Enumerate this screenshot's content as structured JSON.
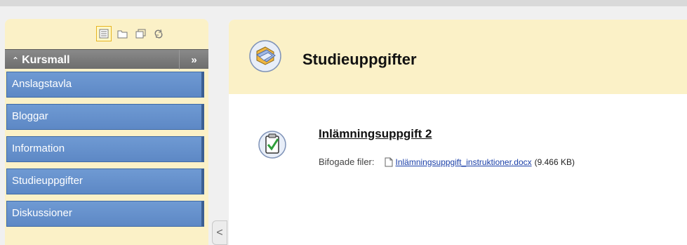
{
  "sidebar": {
    "course_title": "Kursmall",
    "collapse_label": "»",
    "items": [
      {
        "label": "Anslagstavla"
      },
      {
        "label": "Bloggar"
      },
      {
        "label": "Information"
      },
      {
        "label": "Studieuppgifter"
      },
      {
        "label": "Diskussioner"
      }
    ],
    "toolbar_icons": [
      "list-view-icon",
      "folder-view-icon",
      "window-view-icon",
      "refresh-icon"
    ],
    "colors": {
      "nav_bg": "#6f9ad3",
      "panel_bg": "#fbf1c7",
      "header_bg": "#7b7b7b"
    }
  },
  "collapse_tab": {
    "label": "<"
  },
  "main": {
    "page_title": "Studieuppgifter",
    "assignment": {
      "title": "Inlämningsuppgift 2",
      "attachments_label": "Bifogade filer:",
      "file_name": "Inlämningsuppgift_instruktioner.docx",
      "file_size": "(9.466 KB)"
    }
  }
}
